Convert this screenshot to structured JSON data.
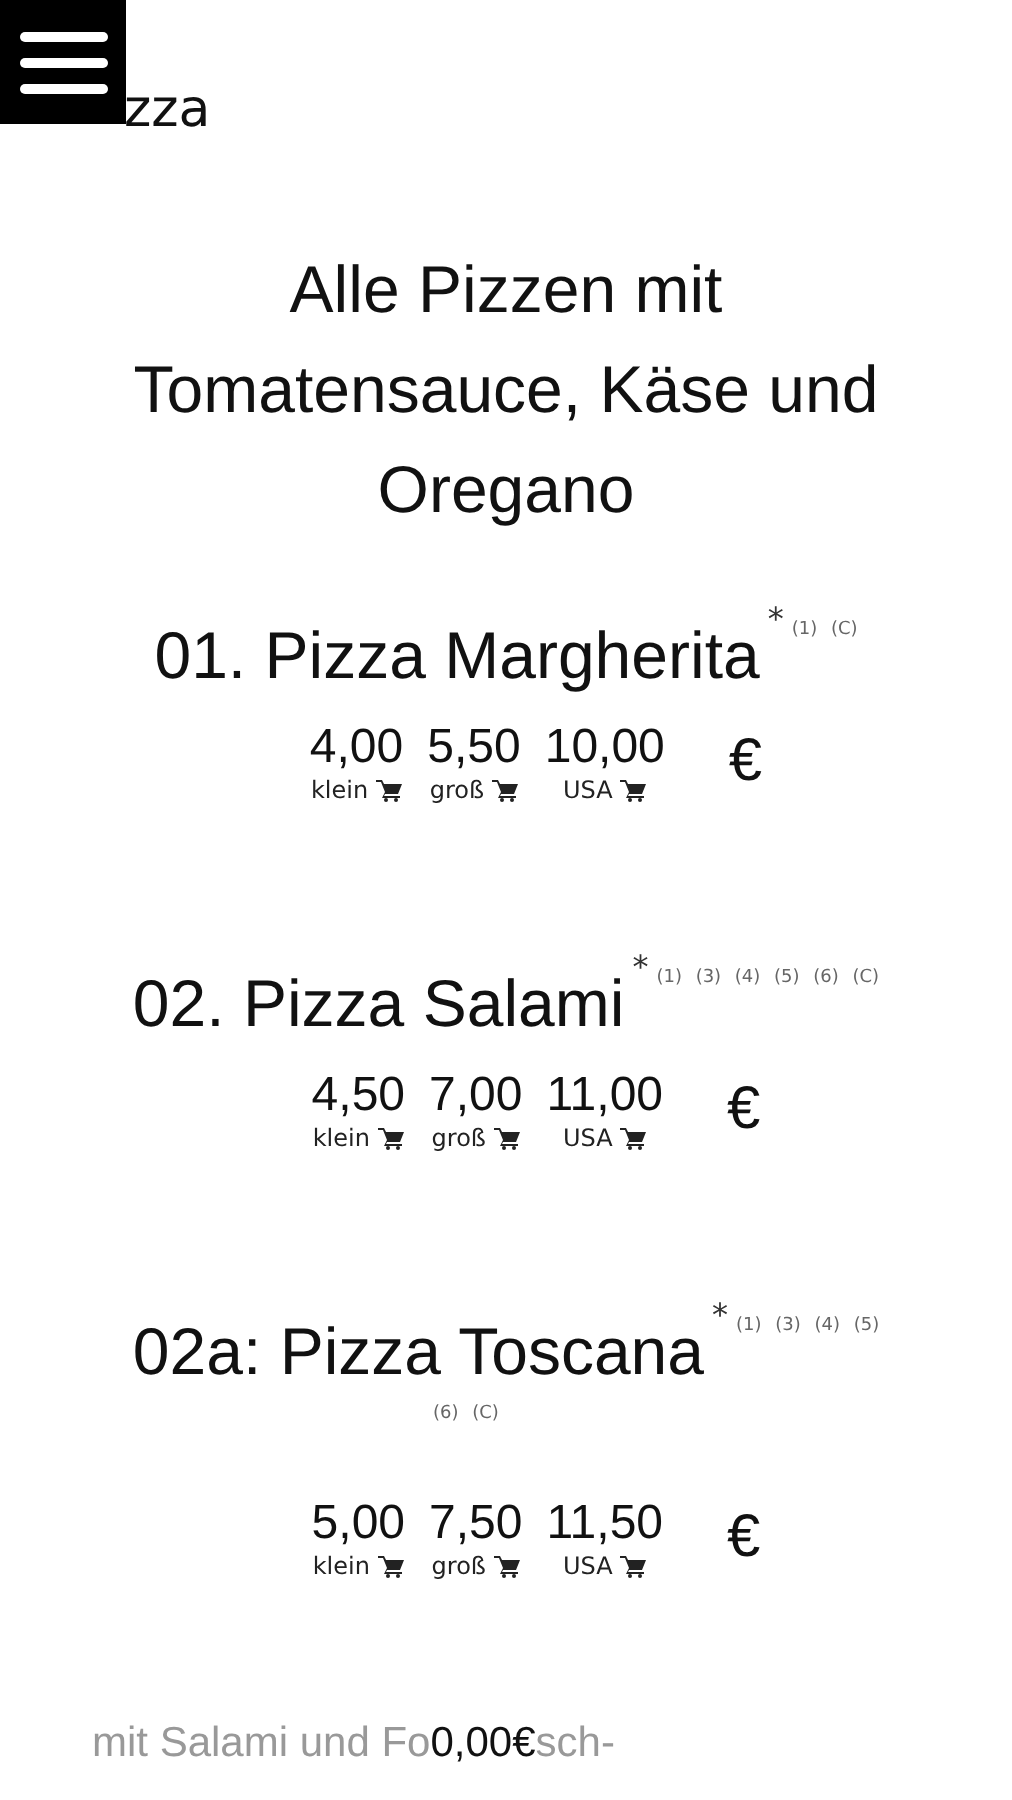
{
  "header": {
    "title": "zza"
  },
  "intro": "Alle Pizzen mit Tomatensauce, Käse und Oregano",
  "items": [
    {
      "name": "01. Pizza Margherita",
      "star": "*",
      "allergens": [
        "(1) (C)"
      ],
      "prices": [
        {
          "value": "4,00",
          "size": "klein"
        },
        {
          "value": "5,50",
          "size": "groß"
        },
        {
          "value": "10,00",
          "size": "USA"
        }
      ],
      "currency": "€"
    },
    {
      "name": "02. Pizza Salami",
      "star": "*",
      "allergens": [
        "(1) (3) (4) (5) (6) (C)"
      ],
      "prices": [
        {
          "value": "4,50",
          "size": "klein"
        },
        {
          "value": "7,00",
          "size": "groß"
        },
        {
          "value": "11,00",
          "size": "USA"
        }
      ],
      "currency": "€"
    },
    {
      "name": "02a: Pizza Toscana",
      "star": "*",
      "allergens": [
        "(1) (3) (4) (5)",
        "(6) (C)"
      ],
      "prices": [
        {
          "value": "5,00",
          "size": "klein"
        },
        {
          "value": "7,50",
          "size": "groß"
        },
        {
          "value": "11,50",
          "size": "USA"
        }
      ],
      "currency": "€"
    }
  ],
  "footer": {
    "description_start": "mit Salami und Fo",
    "total": "0,00€",
    "description_end": "sch-"
  }
}
